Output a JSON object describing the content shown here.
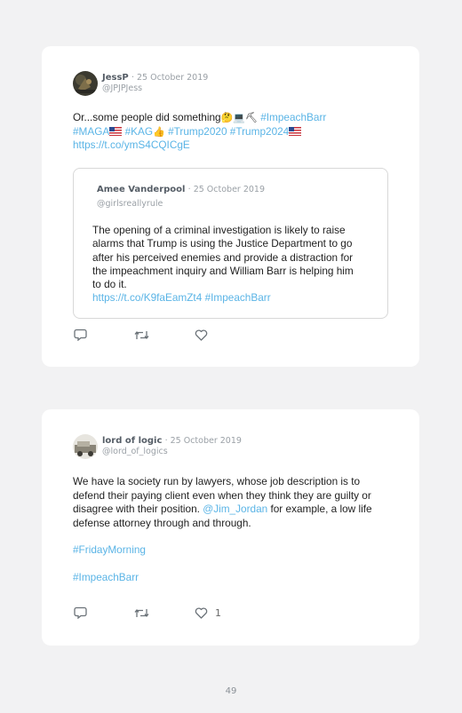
{
  "tweet1": {
    "name": "JessP",
    "date": "· 25 October 2019",
    "handle": "@JPJPJess",
    "text_start": "Or...some people did something",
    "emojis1": "🤔💻⛏",
    "hashtag_impeach": "#ImpeachBarr",
    "hashtag_maga": "#MAGA",
    "hashtag_kag": "#KAG",
    "thumb_emoji": "👍",
    "hashtag_trump2020": "#Trump2020",
    "hashtag_trump2024": "#Trump2024",
    "link": "https://t.co/ymS4CQICgE",
    "quote": {
      "name": "Amee Vanderpool",
      "date": "· 25 October 2019",
      "handle": "@girlsreallyrule",
      "text": "The opening of a criminal investigation is likely to raise alarms that Trump is using the Justice Department to go after his perceived enemies and provide a distraction for the impeachment inquiry and William Barr is helping him to do it.",
      "link": "https://t.co/K9faEamZt4",
      "hashtag": "#ImpeachBarr"
    },
    "actions": {
      "reply_icon": "reply-icon",
      "retweet_icon": "retweet-icon",
      "like_icon": "heart-icon"
    }
  },
  "tweet2": {
    "name": "lord of logic",
    "date": "· 25 October 2019",
    "handle": "@lord_of_logics",
    "text_before": "We have la society run by lawyers, whose job description is to defend their paying client even when they think they are guilty or disagree with their position.",
    "mention": "@Jim_Jordan",
    "text_after": "for example, a low life defense attorney through and through.",
    "hashtag1": "#FridayMorning",
    "hashtag2": "#ImpeachBarr",
    "likes": "1"
  },
  "page_number": "49",
  "colors": {
    "link": "#5ab4e6",
    "name": "#555d66",
    "muted": "#9aa0a6"
  }
}
